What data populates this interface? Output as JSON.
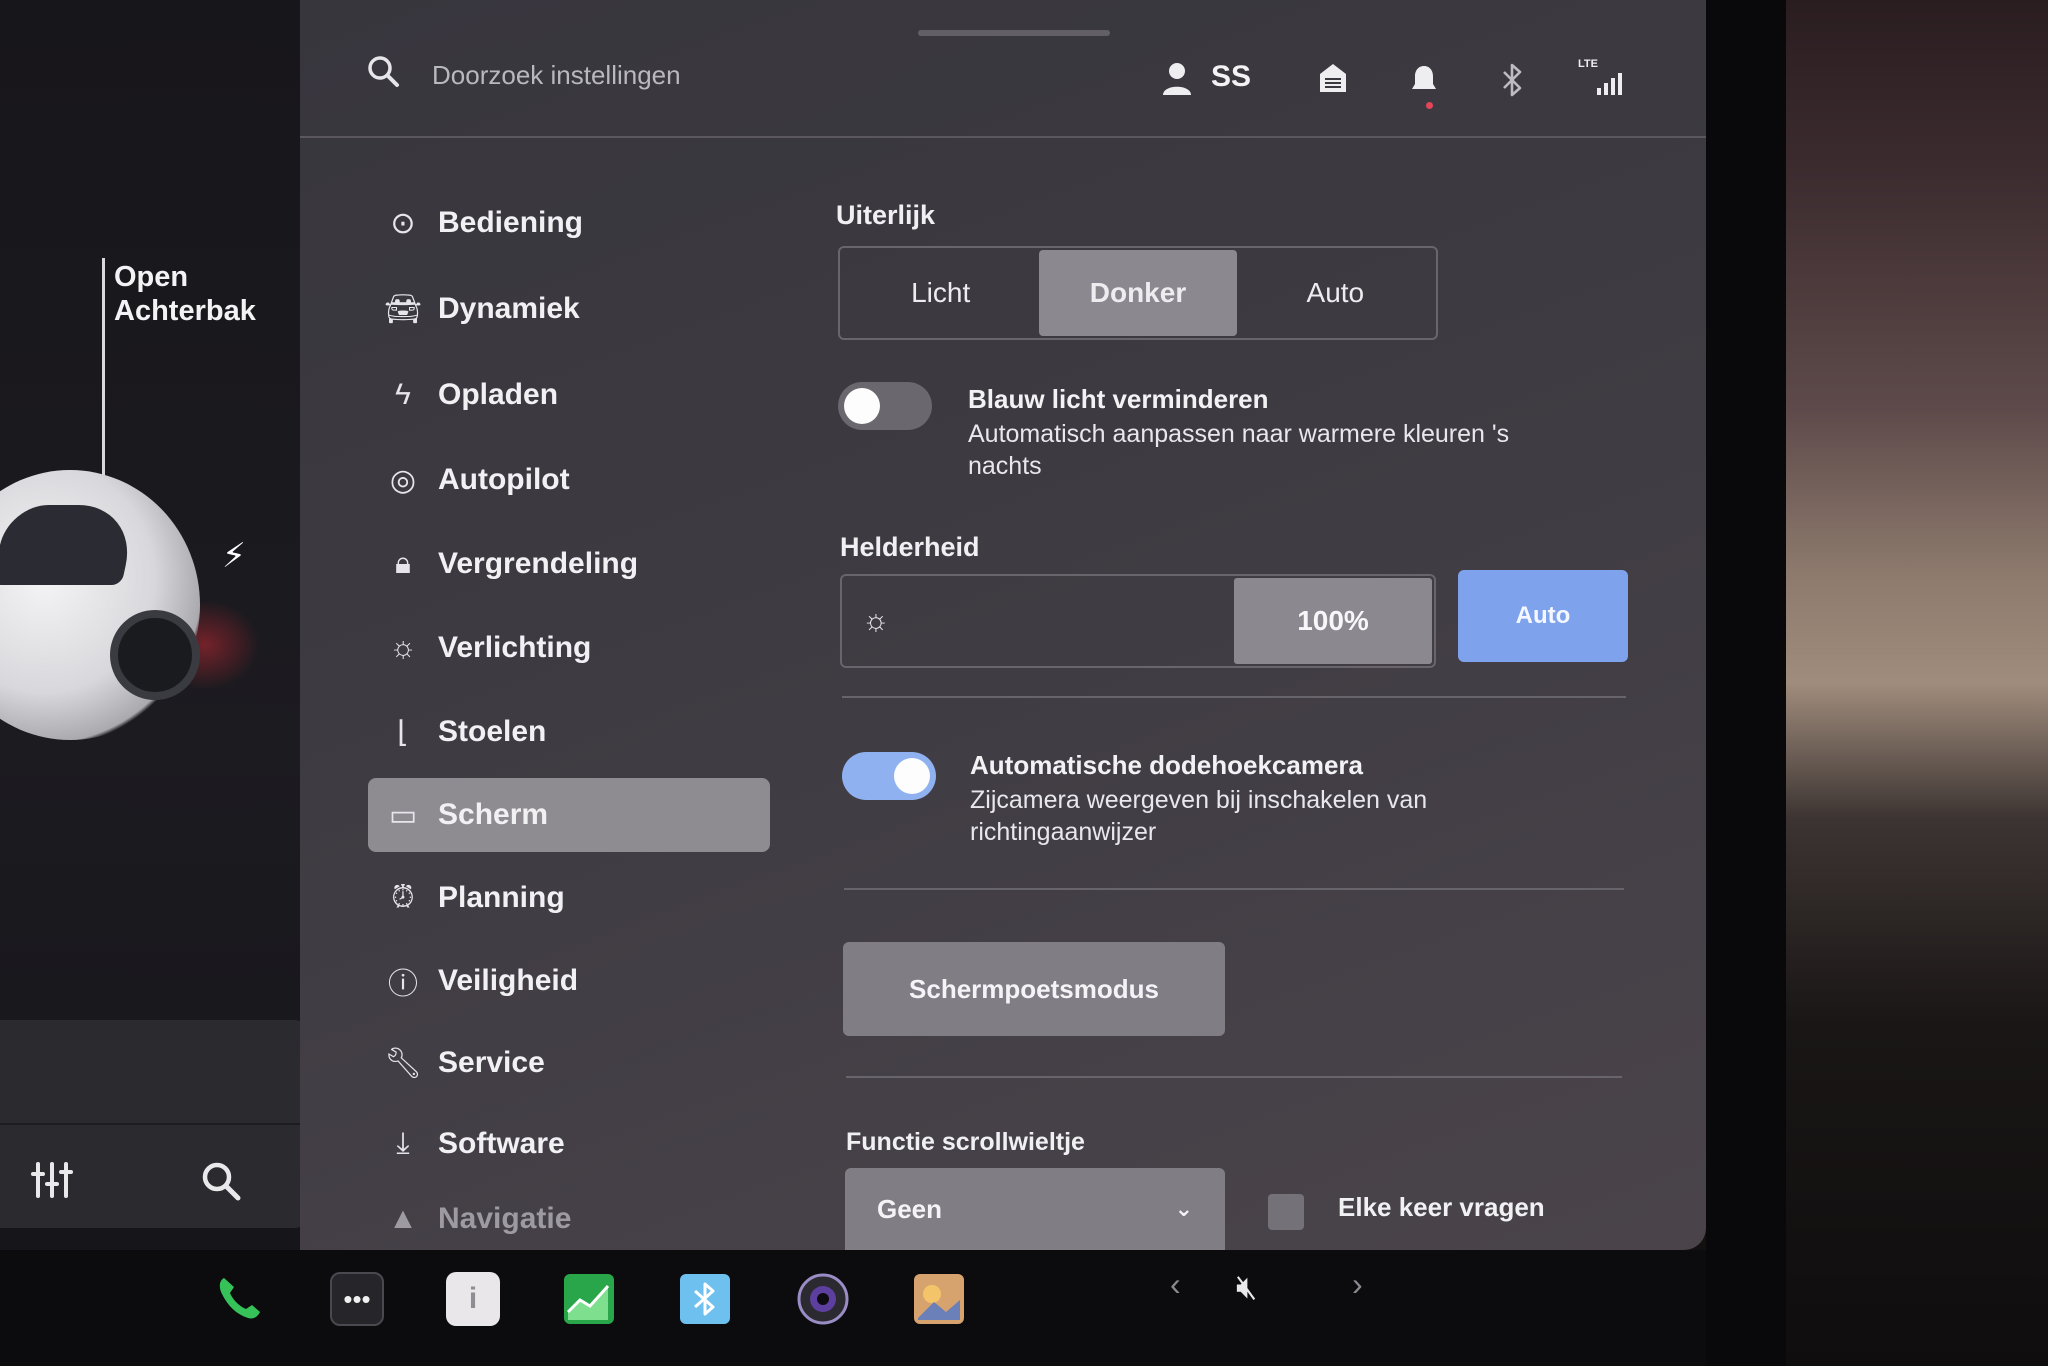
{
  "car": {
    "trunk_label_line1": "Open",
    "trunk_label_line2": "Achterbak",
    "charging_icon": "lightning-bolt-icon",
    "controls": [
      "sliders-icon",
      "search-icon"
    ]
  },
  "topbar": {
    "search_placeholder": "Doorzoek instellingen",
    "profile_initials": "SS",
    "icons": [
      "profile-icon",
      "garage-icon",
      "bell-icon",
      "bluetooth-icon",
      "lte-signal-icon"
    ],
    "lte_label": "LTE"
  },
  "sidebar": {
    "items": [
      {
        "label": "Bediening",
        "icon": "toggle-icon"
      },
      {
        "label": "Dynamiek",
        "icon": "car-icon"
      },
      {
        "label": "Opladen",
        "icon": "lightning-icon"
      },
      {
        "label": "Autopilot",
        "icon": "steering-wheel-icon"
      },
      {
        "label": "Vergrendeling",
        "icon": "lock-icon"
      },
      {
        "label": "Verlichting",
        "icon": "sun-icon"
      },
      {
        "label": "Stoelen",
        "icon": "seat-icon"
      },
      {
        "label": "Scherm",
        "icon": "display-icon",
        "active": true
      },
      {
        "label": "Planning",
        "icon": "alarm-clock-icon"
      },
      {
        "label": "Veiligheid",
        "icon": "alert-circle-icon"
      },
      {
        "label": "Service",
        "icon": "wrench-icon"
      },
      {
        "label": "Software",
        "icon": "download-icon"
      },
      {
        "label": "Navigatie",
        "icon": "navigation-arrow-icon"
      }
    ]
  },
  "display": {
    "appearance_heading": "Uiterlijk",
    "appearance_options": [
      "Licht",
      "Donker",
      "Auto"
    ],
    "appearance_selected": "Donker",
    "blue_light": {
      "title": "Blauw licht verminderen",
      "description": "Automatisch aanpassen naar warmere kleuren 's nachts",
      "enabled": false
    },
    "brightness_heading": "Helderheid",
    "brightness_value": "100%",
    "brightness_level": 1.0,
    "brightness_auto_label": "Auto",
    "blind_spot": {
      "title": "Automatische dodehoekcamera",
      "description": "Zijcamera weergeven bij inschakelen van richtingaanwijzer",
      "enabled": true
    },
    "wipe_button_label": "Schermpoetsmodus",
    "scroll_heading": "Functie scrollwieltje",
    "scroll_selected": "Geen",
    "ask_every_time_label": "Elke keer vragen",
    "ask_every_time_checked": false
  },
  "colors": {
    "accent_blue": "#7ea3ec",
    "toggle_on": "#8fb1ef",
    "selected_segment": "#8b888f"
  },
  "dock": {
    "apps": [
      "phone-icon",
      "more-icon",
      "manual-icon",
      "energy-chart-icon",
      "bluetooth-app-icon",
      "camera-icon",
      "toybox-icon"
    ],
    "volume_icon": "mute-icon"
  }
}
